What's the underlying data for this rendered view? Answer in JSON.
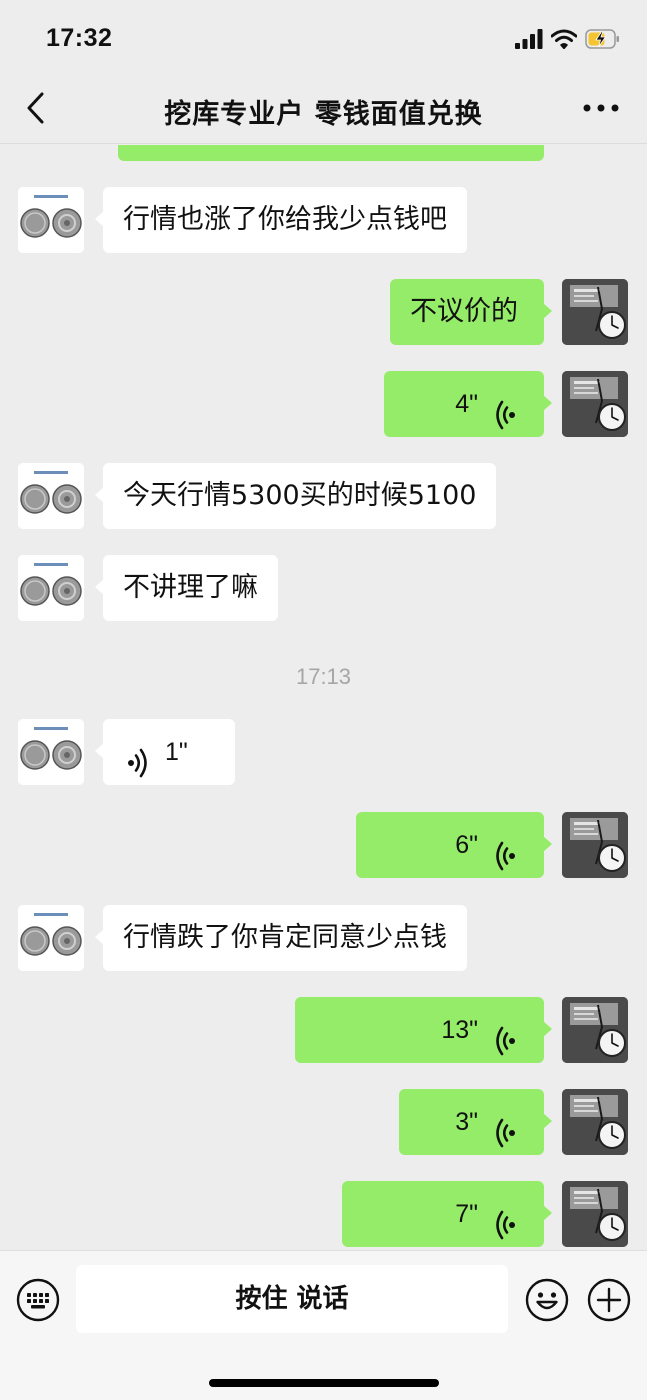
{
  "status_bar": {
    "time": "17:32"
  },
  "header": {
    "title": "挖库专业户  零钱面值兑换"
  },
  "messages": [
    {
      "side": "left",
      "kind": "text",
      "text": "行情也涨了你给我少点钱吧"
    },
    {
      "side": "right",
      "kind": "text",
      "text": "不议价的"
    },
    {
      "side": "right",
      "kind": "voice",
      "duration": "4\""
    },
    {
      "side": "left",
      "kind": "text",
      "text": "今天行情5300买的时候5100"
    },
    {
      "side": "left",
      "kind": "text",
      "text": "不讲理了嘛"
    },
    {
      "side": "left",
      "kind": "voice",
      "duration": "1\""
    },
    {
      "side": "right",
      "kind": "voice",
      "duration": "6\""
    },
    {
      "side": "left",
      "kind": "text",
      "text": "行情跌了你肯定同意少点钱"
    },
    {
      "side": "right",
      "kind": "voice",
      "duration": "13\""
    },
    {
      "side": "right",
      "kind": "voice",
      "duration": "3\""
    },
    {
      "side": "right",
      "kind": "voice",
      "duration": "7\""
    }
  ],
  "timestamp": "17:13",
  "input_bar": {
    "hold_to_talk_label": "按住 说话"
  },
  "colors": {
    "sent_bubble": "#95ec69",
    "received_bubble": "#ffffff",
    "background": "#ededed"
  },
  "icons": {
    "back": "chevron-left-icon",
    "more": "more-dots-icon",
    "voice": "voice-wave-icon",
    "keyboard": "keyboard-icon",
    "emoji": "emoji-icon",
    "plus": "plus-icon",
    "left_avatar": "coin-avatar",
    "right_avatar": "clock-avatar"
  }
}
